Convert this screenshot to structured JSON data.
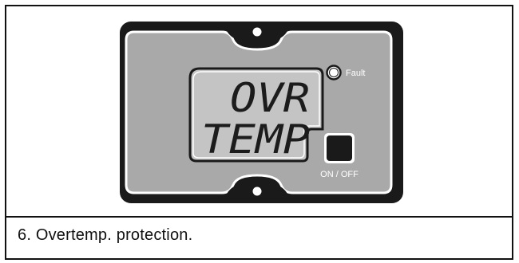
{
  "display": {
    "line1": "OVR",
    "line2": "TEMP"
  },
  "indicators": {
    "fault_label": "Fault",
    "power_label": "ON / OFF"
  },
  "caption": "6. Overtemp. protection.",
  "icons": {
    "mount_hole_top": "circle-hole-icon",
    "mount_hole_bottom": "circle-hole-icon",
    "fault_led": "led-indicator-icon",
    "power_button": "square-button-icon"
  },
  "colors": {
    "bezel": "#1a1a1a",
    "panel": "#a9a9a9",
    "lcd": "#c4c4c4",
    "outline": "#ffffff"
  }
}
